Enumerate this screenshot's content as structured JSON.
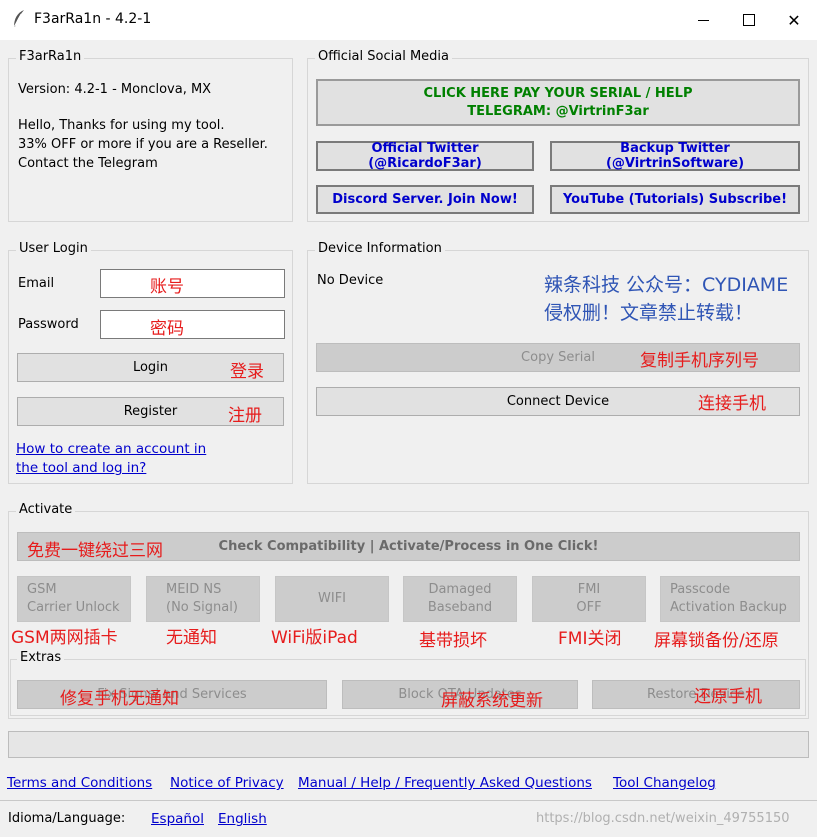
{
  "window": {
    "title": "F3arRa1n - 4.2-1",
    "icon": "feather-icon",
    "minimize": "minimize-icon",
    "maximize": "maximize-icon",
    "close": "✕"
  },
  "info": {
    "group_label": "F3arRa1n",
    "version": "Version: 4.2-1 - Monclova, MX",
    "line1": "Hello, Thanks for using my tool.",
    "line2": "33% OFF or more if you are a Reseller.",
    "line3": "Contact the Telegram"
  },
  "social": {
    "group_label": "Official Social Media",
    "serial_line1": "CLICK HERE PAY YOUR SERIAL / HELP",
    "serial_line2": "TELEGRAM: @VirtrinF3ar",
    "twitter_official": "Official Twitter (@RicardoF3ar)",
    "twitter_backup": "Backup Twitter (@VirtrinSoftware)",
    "discord": "Discord Server. Join Now!",
    "youtube": "YouTube (Tutorials) Subscribe!"
  },
  "login": {
    "group_label": "User Login",
    "email_label": "Email",
    "email_annotation": "账号",
    "password_label": "Password",
    "password_annotation": "密码",
    "login_button": "Login",
    "login_annotation": "登录",
    "register_button": "Register",
    "register_annotation": "注册",
    "help_link_line1": "How to create an account in",
    "help_link_line2": "the tool and log in?"
  },
  "device": {
    "group_label": "Device Information",
    "status": "No Device",
    "watermark_line1": "辣条科技 公众号：CYDIAME",
    "watermark_line2": "侵权删！文章禁止转载！",
    "copy_serial": "Copy Serial",
    "copy_serial_annotation": "复制手机序列号",
    "connect": "Connect Device",
    "connect_annotation": "连接手机"
  },
  "activate": {
    "group_label": "Activate",
    "check_button": "Check Compatibility | Activate/Process in One Click!",
    "check_annotation": "免费一键绕过三网",
    "tiles": [
      {
        "line1": "GSM",
        "line2": "Carrier Unlock",
        "annotation": "GSM两网插卡"
      },
      {
        "line1": "MEID NS",
        "line2": "(No Signal)",
        "annotation": "无通知"
      },
      {
        "line1": "WIFI",
        "line2": "",
        "annotation": "WiFi版iPad"
      },
      {
        "line1": "Damaged",
        "line2": "Baseband",
        "annotation": "基带损坏"
      },
      {
        "line1": "FMI",
        "line2": "OFF",
        "annotation": "FMI关闭"
      },
      {
        "line1": "Passcode",
        "line2": "Activation Backup",
        "annotation": "屏幕锁备份/还原"
      }
    ]
  },
  "extras": {
    "group_label": "Extras",
    "fix_button": "Fix Signal and Services",
    "fix_annotation": "修复手机无通知",
    "block_button": "Block OTA Updates",
    "block_annotation": "屏蔽系统更新",
    "restore_button": "Restore Device",
    "restore_annotation": "还原手机"
  },
  "progress": {
    "value": 0
  },
  "links": {
    "terms": "Terms and Conditions",
    "privacy": "Notice of Privacy",
    "manual": "Manual / Help / Frequently Asked Questions",
    "changelog": "Tool Changelog"
  },
  "language": {
    "label": "Idioma/Language:",
    "spanish": "Español",
    "english": "English"
  },
  "watermark": "https://blog.csdn.net/weixin_49755150"
}
